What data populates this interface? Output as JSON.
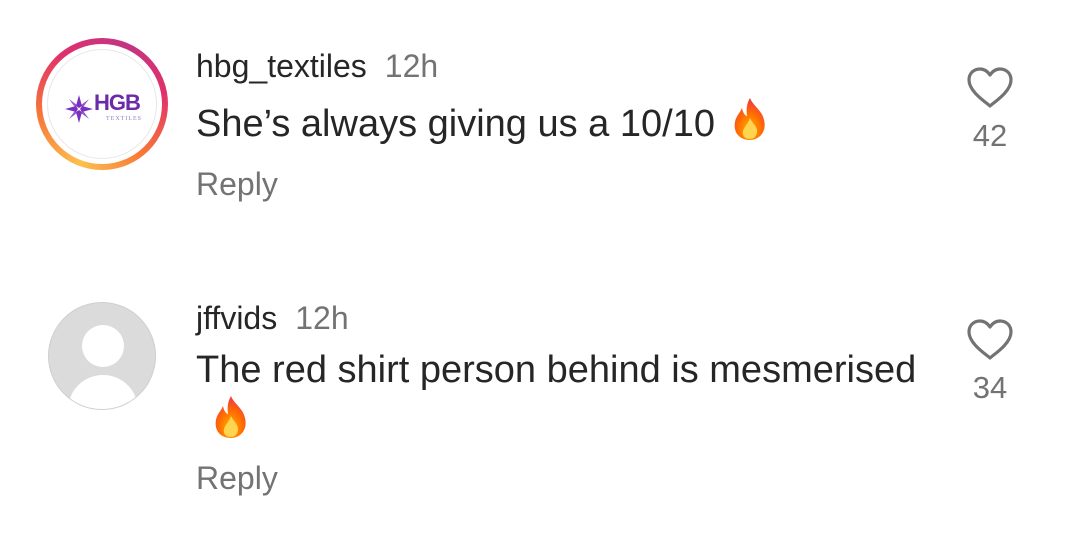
{
  "comments": [
    {
      "username": "hbg_textiles",
      "time": "12h",
      "text": "She’s always giving us a 10/10",
      "emoji": "fire-emoji",
      "reply_label": "Reply",
      "likes": "42",
      "avatar": {
        "type": "brand-logo",
        "logo_text": "HGB",
        "logo_subtext": "TEXTILES",
        "story_ring": true
      }
    },
    {
      "username": "jffvids",
      "time": "12h",
      "text": "The red shirt person behind is mesmerised",
      "emoji": "fire-emoji",
      "reply_label": "Reply",
      "likes": "34",
      "avatar": {
        "type": "default-profile"
      }
    }
  ],
  "icons": {
    "like": "heart-outline-icon",
    "reaction": "fire-emoji"
  },
  "colors": {
    "text": "#262626",
    "secondary": "#737373",
    "logo": "#6b2aa8",
    "ring_start": "#fdc04f",
    "ring_end": "#c13584"
  }
}
